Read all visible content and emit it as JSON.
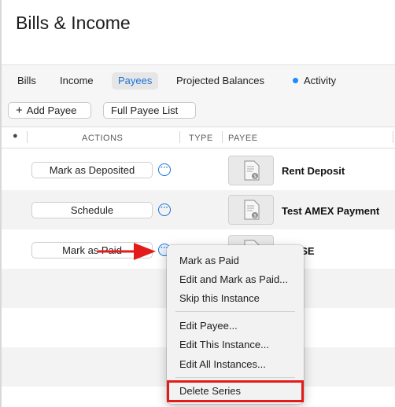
{
  "header": {
    "title": "Bills & Income"
  },
  "tabs": [
    {
      "label": "Bills",
      "active": false
    },
    {
      "label": "Income",
      "active": false
    },
    {
      "label": "Payees",
      "active": true
    },
    {
      "label": "Projected Balances",
      "active": false
    },
    {
      "label": "Activity",
      "active": false,
      "indicator": "blue-dot"
    }
  ],
  "toolbar": {
    "add_payee_label": "Add Payee",
    "add_icon": "plus",
    "full_list_label": "Full Payee List"
  },
  "columns": {
    "actions": "ACTIONS",
    "type": "TYPE",
    "payee": "PAYEE"
  },
  "rows": [
    {
      "action_label": "Mark as Deposited",
      "payee": "Rent Deposit"
    },
    {
      "action_label": "Schedule",
      "payee": "Test AMEX Payment"
    },
    {
      "action_label": "Mark as Paid",
      "payee": "...ASE"
    }
  ],
  "context_menu": {
    "groups": [
      [
        "Mark as Paid",
        "Edit and Mark as Paid...",
        "Skip this Instance"
      ],
      [
        "Edit Payee...",
        "Edit This Instance...",
        "Edit All Instances..."
      ],
      [
        "Delete Series"
      ]
    ],
    "highlighted_item": "Delete Series"
  },
  "colors": {
    "accent": "#1a73d9",
    "annotation": "#e31b1b",
    "active_tab_bg": "#e6e6e6"
  }
}
